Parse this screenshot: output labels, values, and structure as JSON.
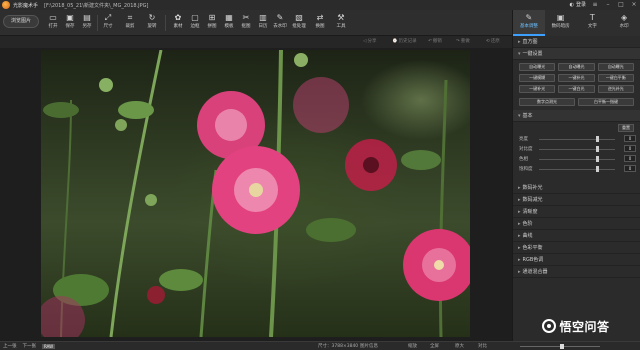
{
  "app": {
    "name": "光影魔术手",
    "file_path": "[F:\\2018_05_21\\新建文件夹\\_MG_2018.JPG]",
    "login_label": "登录"
  },
  "toolbar": {
    "browse_label": "浏览图片",
    "items": [
      {
        "label": "打开",
        "icon": "open-icon"
      },
      {
        "label": "保存",
        "icon": "save-icon"
      },
      {
        "label": "另存",
        "icon": "save-as-icon"
      },
      {
        "label": "尺寸",
        "icon": "size-icon"
      },
      {
        "label": "裁剪",
        "icon": "crop-icon"
      },
      {
        "label": "旋转",
        "icon": "rotate-icon"
      },
      {
        "label": "素材",
        "icon": "material-icon"
      },
      {
        "label": "边框",
        "icon": "border-icon"
      },
      {
        "label": "拼图",
        "icon": "collage-icon"
      },
      {
        "label": "模板",
        "icon": "template-icon"
      },
      {
        "label": "抠图",
        "icon": "cutout-icon"
      },
      {
        "label": "日历",
        "icon": "calendar-icon"
      },
      {
        "label": "去水印",
        "icon": "dewatermark-icon"
      },
      {
        "label": "批处理",
        "icon": "batch-icon"
      },
      {
        "label": "换图",
        "icon": "replace-icon"
      },
      {
        "label": "工具",
        "icon": "tools-icon"
      }
    ]
  },
  "strip": {
    "share": "分享",
    "history": "历史记录",
    "undo": "撤销",
    "redo": "重做",
    "restore": "还原"
  },
  "right_panel": {
    "tabs": [
      {
        "label": "基本调整",
        "icon": "adjust-icon",
        "active": true
      },
      {
        "label": "数码暗房",
        "icon": "darkroom-icon",
        "active": false
      },
      {
        "label": "文字",
        "icon": "text-icon",
        "active": false
      },
      {
        "label": "水印",
        "icon": "watermark-icon",
        "active": false
      }
    ],
    "histogram_label": "直方图",
    "quick_label": "一键设置",
    "quick_buttons": [
      "自动曝光",
      "自动曝光",
      "自动曝光",
      "一键模糊",
      "一键补光",
      "一键白平衡",
      "一键补光",
      "一键白光",
      "逆光补光"
    ],
    "extra_buttons": [
      "数字点测光",
      "白平衡一指键"
    ],
    "basic_label": "基本",
    "reset_label": "重置",
    "sliders": [
      {
        "label": "亮度",
        "value": "0"
      },
      {
        "label": "对比度",
        "value": "0"
      },
      {
        "label": "色相",
        "value": "0"
      },
      {
        "label": "饱和度",
        "value": "0"
      }
    ],
    "collapsed_sections": [
      "数码补光",
      "数码减光",
      "清晰度",
      "色阶",
      "曲线",
      "色彩平衡",
      "RGB色调",
      "通道混合器"
    ]
  },
  "statusbar": {
    "prev": "上一张",
    "next": "下一张",
    "format": "RAW",
    "dimensions": "尺寸：3788×3840",
    "info": "图片信息",
    "zoom": "缩放",
    "fit": "全屏",
    "original": "原大",
    "compare": "对比"
  },
  "watermark": {
    "text": "悟空问答"
  },
  "colors": {
    "accent": "#3da0ff",
    "background": "#1f1f1f",
    "panel": "#2b2b2b"
  }
}
